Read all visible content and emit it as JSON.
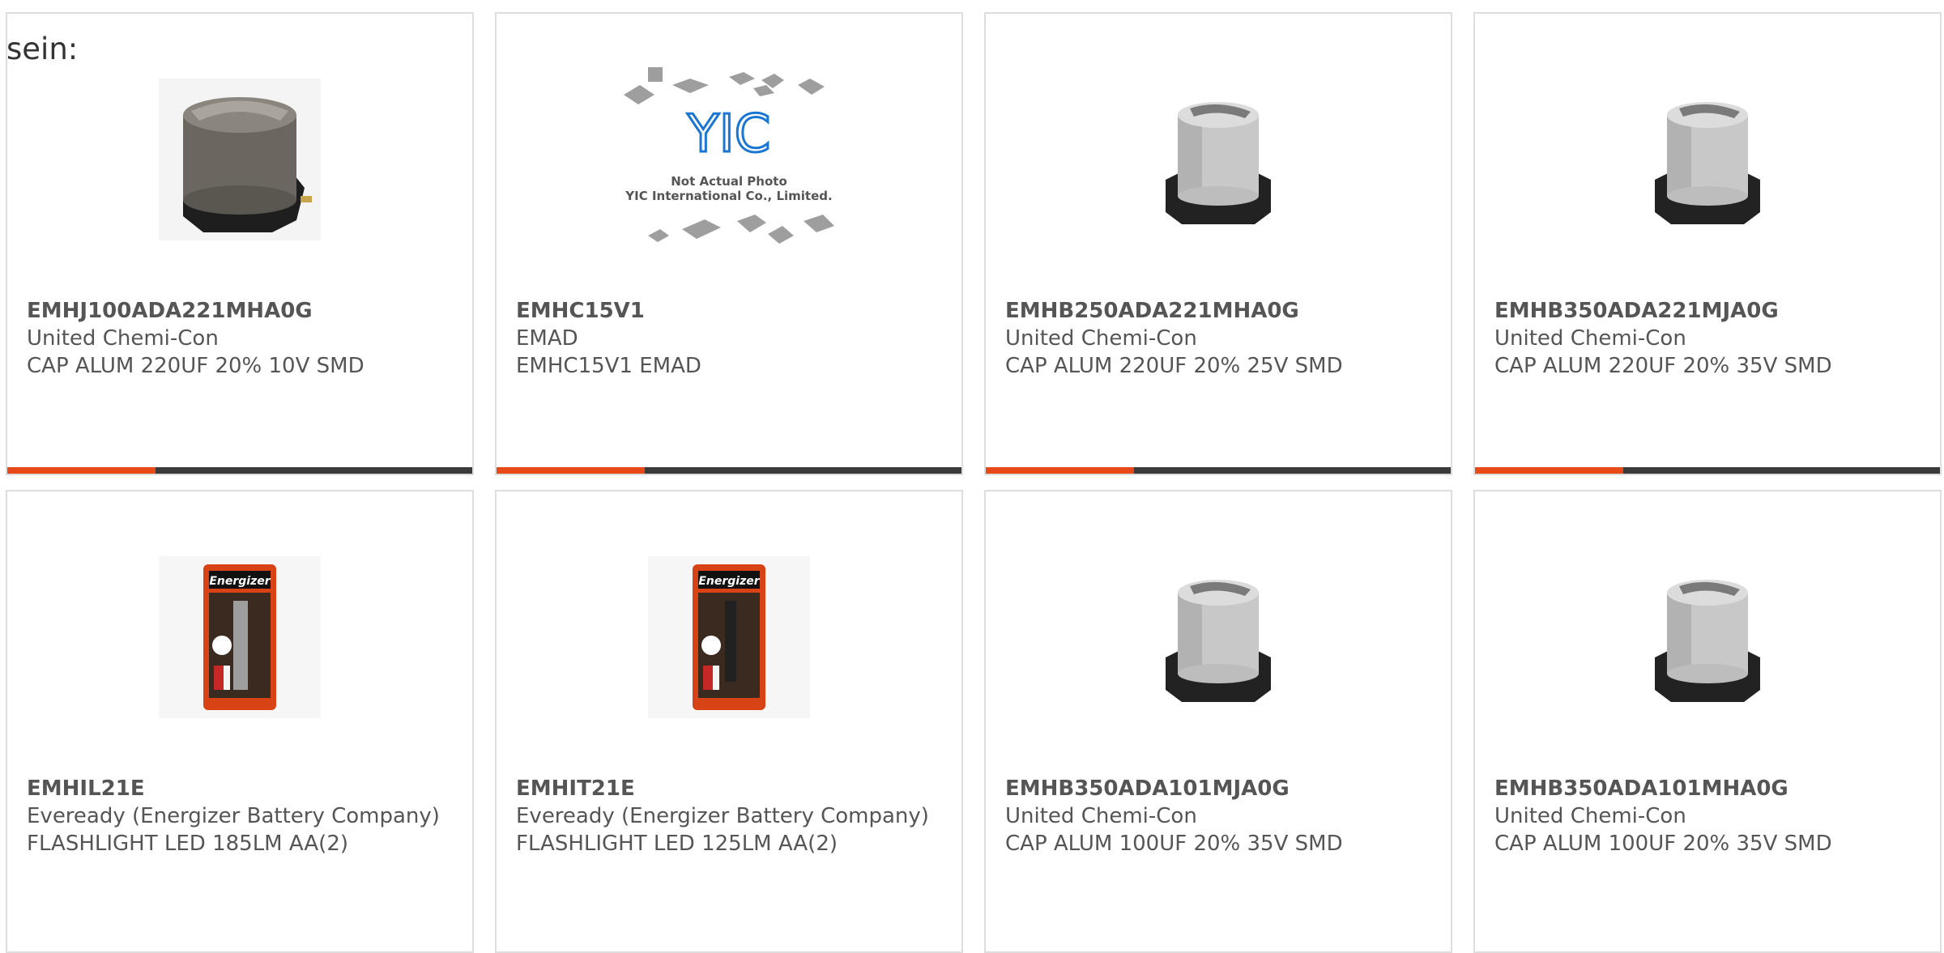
{
  "page": {
    "heading": "sein:"
  },
  "products": [
    {
      "part": "EMHJ100ADA221MHA0G",
      "manufacturer": "United Chemi-Con",
      "description": "CAP ALUM 220UF 20% 10V SMD",
      "image": "capacitor-dark"
    },
    {
      "part": "EMHC15V1",
      "manufacturer": "EMAD",
      "description": "EMHC15V1 EMAD",
      "image": "not-actual-photo",
      "placeholder": {
        "logo": "YIC",
        "line1": "Not Actual Photo",
        "line2": "YIC International Co., Limited."
      }
    },
    {
      "part": "EMHB250ADA221MHA0G",
      "manufacturer": "United Chemi-Con",
      "description": "CAP ALUM 220UF 20% 25V SMD",
      "image": "capacitor-silver"
    },
    {
      "part": "EMHB350ADA221MJA0G",
      "manufacturer": "United Chemi-Con",
      "description": "CAP ALUM 220UF 20% 35V SMD",
      "image": "capacitor-silver"
    },
    {
      "part": "EMHIL21E",
      "manufacturer": "Eveready (Energizer Battery Company)",
      "description": "FLASHLIGHT LED 185LM AA(2)",
      "image": "flashlight-package",
      "brand": "Energizer"
    },
    {
      "part": "EMHIT21E",
      "manufacturer": "Eveready (Energizer Battery Company)",
      "description": "FLASHLIGHT LED 125LM AA(2)",
      "image": "flashlight-package",
      "brand": "Energizer"
    },
    {
      "part": "EMHB350ADA101MJA0G",
      "manufacturer": "United Chemi-Con",
      "description": "CAP ALUM 100UF 20% 35V SMD",
      "image": "capacitor-silver"
    },
    {
      "part": "EMHB350ADA101MHA0G",
      "manufacturer": "United Chemi-Con",
      "description": "CAP ALUM 100UF 20% 35V SMD",
      "image": "capacitor-silver"
    }
  ],
  "colors": {
    "accent": "#e64a19",
    "bar": "#3a3a3a",
    "border": "#dedede"
  }
}
